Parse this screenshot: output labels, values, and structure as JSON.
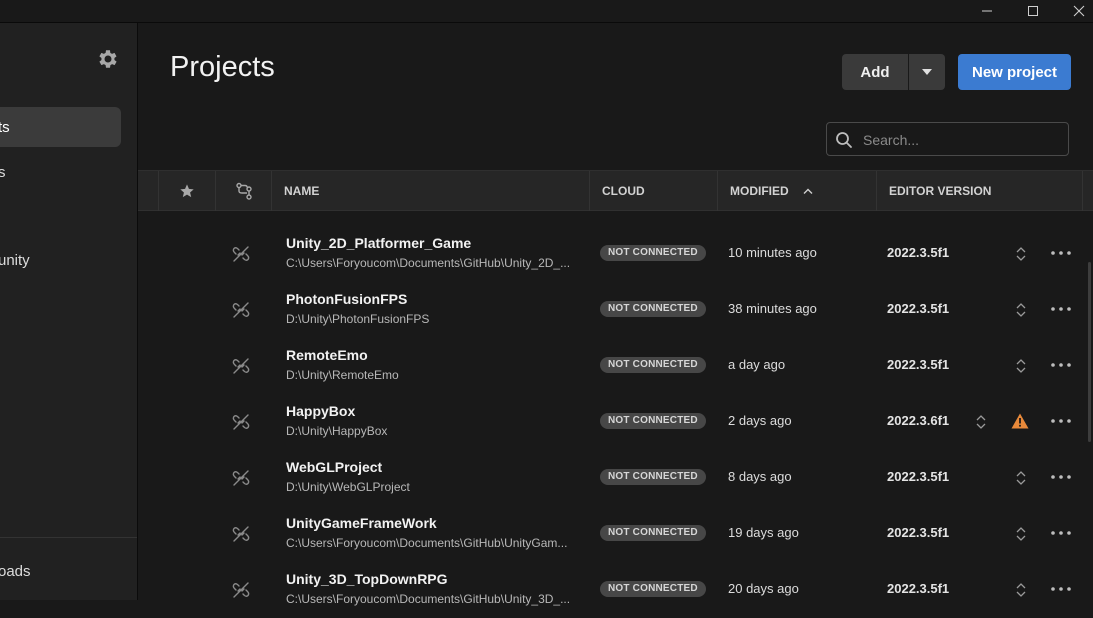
{
  "window": {
    "controls": [
      {
        "name": "minimize",
        "glyph": "─"
      },
      {
        "name": "maximize",
        "glyph": "☐"
      },
      {
        "name": "close",
        "glyph": "✕"
      }
    ]
  },
  "sidebar": {
    "items": [
      {
        "label": "ts",
        "active": true
      },
      {
        "label": "s",
        "active": false
      },
      {
        "label": "unity",
        "active": false
      }
    ],
    "bottom_item": "oads"
  },
  "header": {
    "title": "Projects",
    "add_label": "Add",
    "new_project_label": "New project",
    "search_placeholder": "Search..."
  },
  "table": {
    "columns": {
      "name": "NAME",
      "cloud": "CLOUD",
      "modified": "MODIFIED",
      "editor_version": "EDITOR VERSION"
    },
    "rows": [
      {
        "name": "Unity_2D_Platformer_Game",
        "path": "C:\\Users\\Foryoucom\\Documents\\GitHub\\Unity_2D_...",
        "cloud": "NOT CONNECTED",
        "modified": "10 minutes ago",
        "version": "2022.3.5f1",
        "warning": false
      },
      {
        "name": "PhotonFusionFPS",
        "path": "D:\\Unity\\PhotonFusionFPS",
        "cloud": "NOT CONNECTED",
        "modified": "38 minutes ago",
        "version": "2022.3.5f1",
        "warning": false
      },
      {
        "name": "RemoteEmo",
        "path": "D:\\Unity\\RemoteEmo",
        "cloud": "NOT CONNECTED",
        "modified": "a day ago",
        "version": "2022.3.5f1",
        "warning": false
      },
      {
        "name": "HappyBox",
        "path": "D:\\Unity\\HappyBox",
        "cloud": "NOT CONNECTED",
        "modified": "2 days ago",
        "version": "2022.3.6f1",
        "warning": true
      },
      {
        "name": "WebGLProject",
        "path": "D:\\Unity\\WebGLProject",
        "cloud": "NOT CONNECTED",
        "modified": "8 days ago",
        "version": "2022.3.5f1",
        "warning": false
      },
      {
        "name": "UnityGameFrameWork",
        "path": "C:\\Users\\Foryoucom\\Documents\\GitHub\\UnityGam...",
        "cloud": "NOT CONNECTED",
        "modified": "19 days ago",
        "version": "2022.3.5f1",
        "warning": false
      },
      {
        "name": "Unity_3D_TopDownRPG",
        "path": "C:\\Users\\Foryoucom\\Documents\\GitHub\\Unity_3D_...",
        "cloud": "NOT CONNECTED",
        "modified": "20 days ago",
        "version": "2022.3.5f1",
        "warning": false
      }
    ]
  },
  "colors": {
    "background": "#191919",
    "sidebar": "#212121",
    "accent": "#3b7bd1",
    "warning": "#e8893a"
  }
}
